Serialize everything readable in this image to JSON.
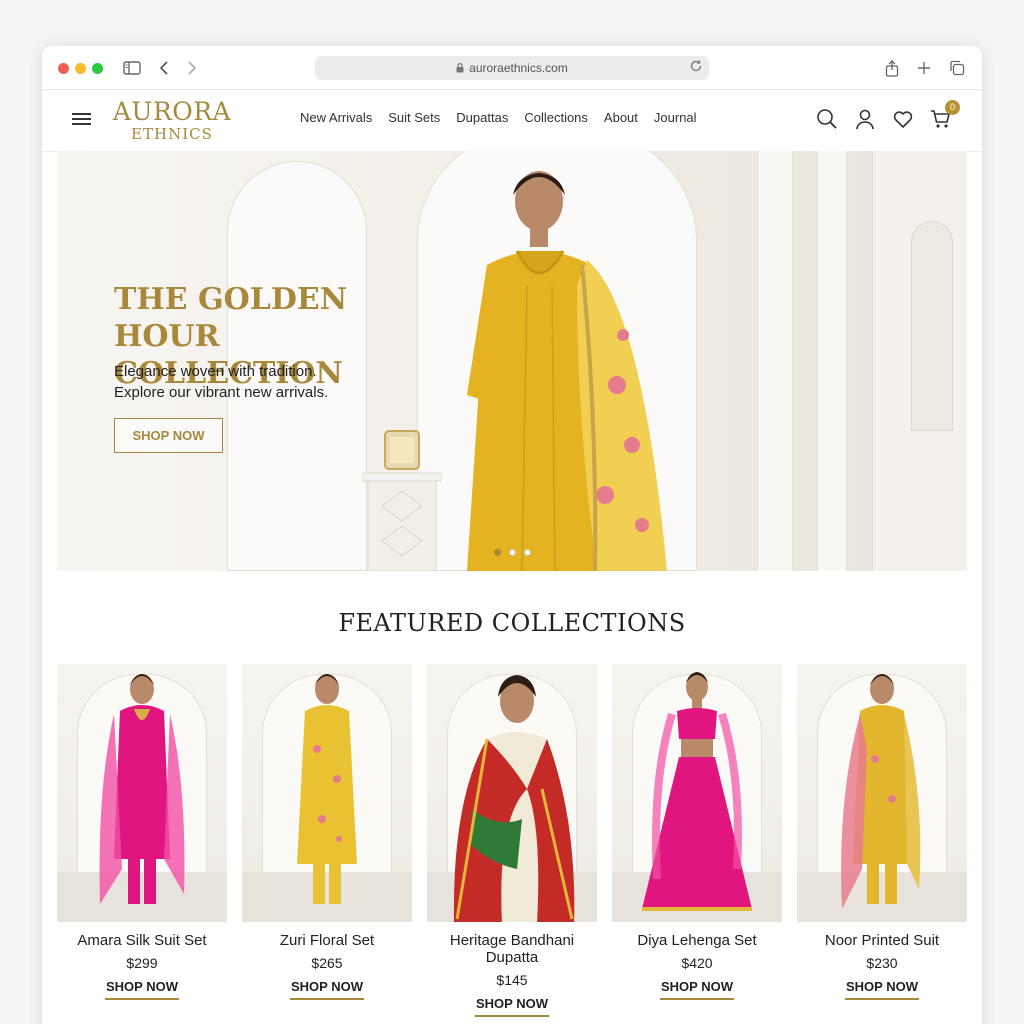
{
  "browser": {
    "url": "auroraethnics.com"
  },
  "header": {
    "logo_line1": "AURORA",
    "logo_line2": "ETHNICS",
    "nav": [
      "New Arrivals",
      "Suit Sets",
      "Dupattas",
      "Collections",
      "About",
      "Journal"
    ],
    "cart_count": "0"
  },
  "hero": {
    "title": "THE GOLDEN HOUR COLLECTION",
    "subtitle_line1": "Elegance woven with tradition.",
    "subtitle_line2": "Explore our vibrant new arrivals.",
    "button": "SHOP NOW",
    "slides": 3,
    "active_slide": 1
  },
  "featured": {
    "title": "FEATURED COLLECTIONS",
    "products": [
      {
        "name": "Amara Silk Suit Set",
        "price": "$299",
        "cta": "SHOP NOW",
        "color": "#e0157f"
      },
      {
        "name": "Zuri Floral Set",
        "price": "$265",
        "cta": "SHOP NOW",
        "color": "#e9c234"
      },
      {
        "name": "Heritage Bandhani Dupatta",
        "price": "$145",
        "cta": "SHOP NOW",
        "color": "#c42a26"
      },
      {
        "name": "Diya Lehenga Set",
        "price": "$420",
        "cta": "SHOP NOW",
        "color": "#e0157f"
      },
      {
        "name": "Noor Printed Suit",
        "price": "$230",
        "cta": "SHOP NOW",
        "color": "#e3b62e"
      }
    ]
  },
  "colors": {
    "gold": "#a8883a",
    "badge": "#b89334"
  }
}
